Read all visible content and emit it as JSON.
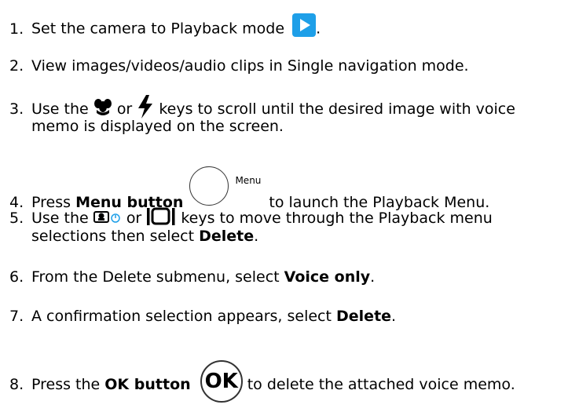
{
  "steps": [
    {
      "num": "1.",
      "text": "Set the camera to Playback mode",
      "after": "."
    },
    {
      "num": "2.",
      "text": "View images/videos/audio clips in Single navigation mode."
    },
    {
      "num": "3.",
      "pre": "Use the",
      "mid": "or",
      "post": "keys to scroll until the desired image with voice",
      "cont": "memo is displayed on the screen."
    },
    {
      "num": "4.",
      "pre": "Press",
      "bold": "Menu button",
      "icon_label": "Menu",
      "post": "to launch the Playback Menu."
    },
    {
      "num": "5.",
      "pre": "Use the",
      "mid": "or",
      "post": "keys to move through the Playback menu",
      "cont_pre": "selections then select",
      "cont_bold": "Delete",
      "cont_post": "."
    },
    {
      "num": "6.",
      "pre": "From the Delete submenu, select",
      "bold": "Voice only",
      "post": "."
    },
    {
      "num": "7.",
      "pre": "A confirmation selection appears, select",
      "bold": "Delete",
      "post": "."
    },
    {
      "num": "8.",
      "pre": "Press the",
      "bold": "OK button",
      "icon_label": "OK",
      "post": "to delete the attached voice memo."
    }
  ],
  "icons": {
    "playback": "playback-mode-icon",
    "macro": "macro-flower-icon",
    "flash": "flash-bolt-icon",
    "selftimer": "self-timer-icon",
    "display": "display-icon",
    "menu": "menu-button-icon",
    "ok": "ok-button-icon"
  },
  "colors": {
    "playback_icon": "#1e9fe8",
    "text": "#000000"
  }
}
